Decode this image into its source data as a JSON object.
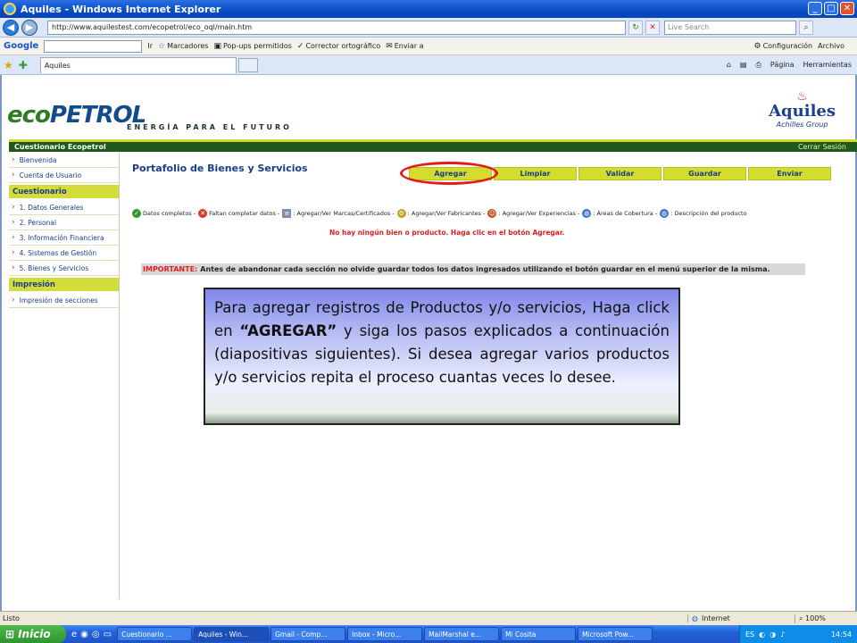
{
  "window": {
    "title": "Aquiles - Windows Internet Explorer"
  },
  "address": {
    "url": "http://www.aquilestest.com/ecopetrol/eco_oql/main.htm",
    "search_placeholder": "Live Search"
  },
  "googlebar": {
    "logo": "Google",
    "ir": "Ir",
    "marcadores": "Marcadores",
    "popups": "Pop-ups permitidos",
    "corrector": "Corrector ortográfico",
    "enviar": "Enviar a",
    "config": "Configuración",
    "archivo": "Archivo"
  },
  "tabs": {
    "active": "Aquiles",
    "pagina": "Página",
    "herramientas": "Herramientas"
  },
  "site": {
    "logo_main": "ECOPETROL",
    "logo_eco": "eco",
    "logo_petrol": "PETROL",
    "tagline": "ENERGÍA PARA EL FUTURO",
    "partner_brand": "Aquiles",
    "partner_sub": "Achilles Group"
  },
  "greenbar": {
    "title": "Cuestionario Ecopetrol",
    "logout": "Cerrar Sesión"
  },
  "sidebar": {
    "top": [
      "Bienvenida",
      "Cuenta de Usuario"
    ],
    "section1": "Cuestionario",
    "items1": [
      "1. Datos Generales",
      "2. Personal",
      "3. Información Financiera",
      "4. Sistemas de Gestión",
      "5. Bienes y Servicios"
    ],
    "section2": "Impresión",
    "items2": [
      "Impresión de secciones"
    ]
  },
  "main": {
    "title": "Portafolio de Bienes y Servicios",
    "buttons": [
      "Agregar",
      "Limpiar",
      "Validar",
      "Guardar",
      "Enviar"
    ],
    "legend": [
      "Datos completos -",
      "Faltan completar datos -",
      ": Agregar/Ver Marcas/Certificados -",
      ": Agregar/Ver Fabricantes -",
      ": Agregar/Ver Experiencias -",
      ": Áreas de Cobertura -",
      ": Descripción del producto"
    ],
    "empty_msg": "No hay ningún bien o producto. Haga clic en el botón Agregar.",
    "important_label": "IMPORTANTE:",
    "important_text": "Antes de abandonar cada sección no olvide guardar todos los datos ingresados utilizando el botón guardar en el menú superior de la misma."
  },
  "callout": {
    "p1": "Para agregar registros de Productos y/o servicios, Haga click en ",
    "bold": "“AGREGAR”",
    "p2": " y siga los pasos explicados a continuación (diapositivas siguientes). Si desea agregar varios productos y/o servicios repita el proceso cuantas veces lo desee."
  },
  "status": {
    "text": "Listo",
    "zone": "Internet",
    "zoom": "100%"
  },
  "taskbar": {
    "start": "Inicio",
    "tasks": [
      "Cuestionario ...",
      "Aquiles - Win...",
      "Gmail - Comp...",
      "Inbox - Micro...",
      "MailMarshal e...",
      "Mi Cosita",
      "Microsoft Pow..."
    ],
    "lang": "ES",
    "clock": "14:54"
  }
}
